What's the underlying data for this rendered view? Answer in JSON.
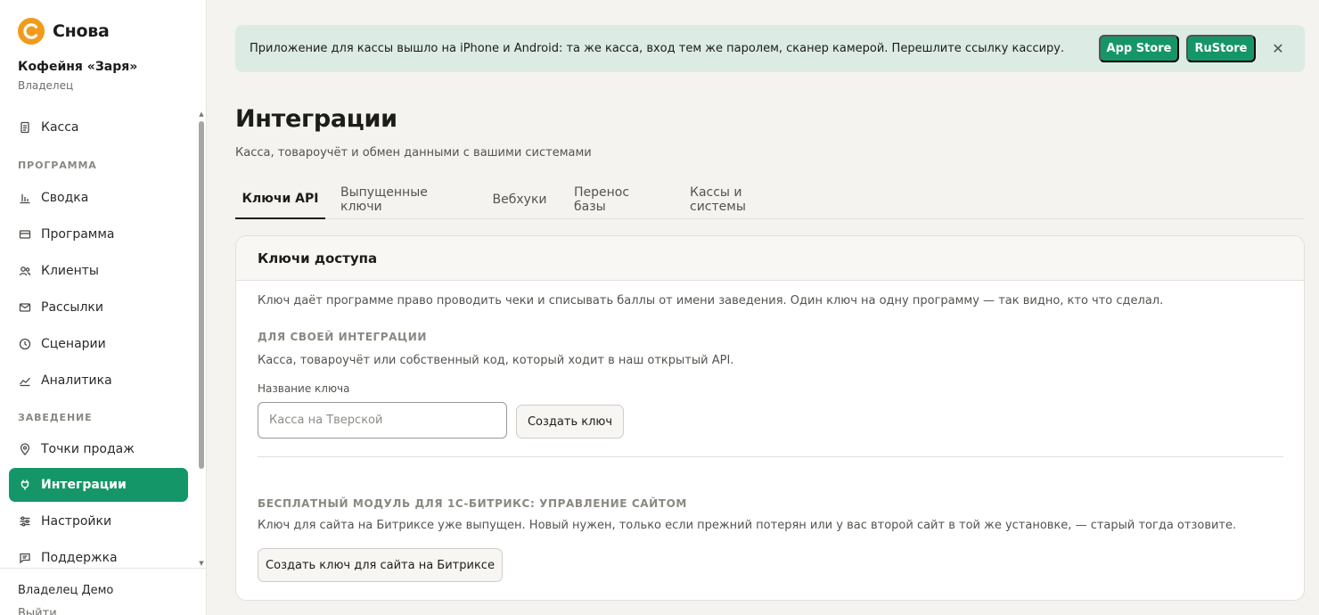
{
  "brand": {
    "name": "Снова",
    "accent": "#F29A1B"
  },
  "org": {
    "name": "Кофейня «Заря»",
    "role": "Владелец"
  },
  "nav": {
    "top": {
      "label": "Касса",
      "icon": "receipt-icon"
    },
    "section_program": "ПРОГРАММА",
    "program_items": [
      {
        "label": "Сводка",
        "icon": "bar-chart-icon"
      },
      {
        "label": "Программа",
        "icon": "card-icon"
      },
      {
        "label": "Клиенты",
        "icon": "users-icon"
      },
      {
        "label": "Рассылки",
        "icon": "mail-icon"
      },
      {
        "label": "Сценарии",
        "icon": "clock-icon"
      },
      {
        "label": "Аналитика",
        "icon": "trend-icon"
      }
    ],
    "section_venue": "ЗАВЕДЕНИЕ",
    "venue_items": [
      {
        "label": "Точки продаж",
        "icon": "pin-icon"
      },
      {
        "label": "Интеграции",
        "icon": "plug-icon",
        "active": true
      },
      {
        "label": "Настройки",
        "icon": "sliders-icon"
      },
      {
        "label": "Поддержка",
        "icon": "chat-icon"
      }
    ],
    "active_color": "#159669"
  },
  "footer": {
    "user": "Владелец Демо",
    "logout": "Выйти"
  },
  "banner": {
    "text": "Приложение для кассы вышло на iPhone и Android: та же касса, вход тем же паролем, сканер камерой. Перешлите ссылку кассиру.",
    "appstore_label": "App Store",
    "rustore_label": "RuStore",
    "close_icon": "close-icon",
    "bg": "#DCEBE3"
  },
  "page": {
    "title": "Интеграции",
    "subtitle": "Касса, товароучёт и обмен данными с вашими системами"
  },
  "tabs": [
    {
      "label": "Ключи API",
      "active": true
    },
    {
      "label": "Выпущенные ключи"
    },
    {
      "label": "Вебхуки"
    },
    {
      "label": "Перенос базы"
    },
    {
      "label": "Кассы и системы"
    }
  ],
  "card": {
    "title": "Ключи доступа",
    "description": "Ключ даёт программе право проводить чеки и списывать баллы от имени заведения. Один ключ на одну программу — так видно, кто что сделал.",
    "own": {
      "heading": "ДЛЯ СВОЕЙ ИНТЕГРАЦИИ",
      "text": "Касса, товароучёт или собственный код, который ходит в наш открытый API.",
      "field_label": "Название ключа",
      "placeholder": "Касса на Тверской",
      "value": "",
      "create_label": "Создать ключ"
    },
    "bitrix": {
      "heading": "БЕСПЛАТНЫЙ МОДУЛЬ ДЛЯ 1С-БИТРИКС: УПРАВЛЕНИЕ САЙТОМ",
      "text": "Ключ для сайта на Битриксе уже выпущен. Новый нужен, только если прежний потерян или у вас второй сайт в той же установке, — старый тогда отзовите.",
      "create_label": "Создать ключ для сайта на Битриксе"
    }
  }
}
